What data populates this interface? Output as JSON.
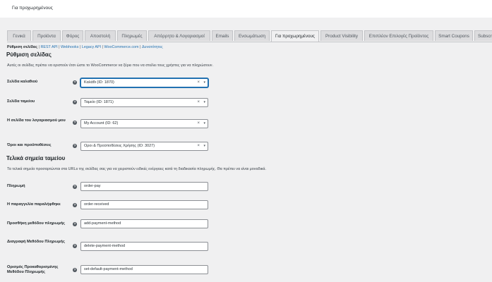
{
  "header": {
    "title": "Για προχωρημένους"
  },
  "tabs": [
    {
      "label": "Γενικά"
    },
    {
      "label": "Προϊόντα"
    },
    {
      "label": "Φόρος"
    },
    {
      "label": "Αποστολή"
    },
    {
      "label": "Πληρωμές"
    },
    {
      "label": "Απόρρητο & Λογαριασμοί"
    },
    {
      "label": "Emails"
    },
    {
      "label": "Ενσωμάτωση"
    },
    {
      "label": "Για προχωρημένους"
    },
    {
      "label": "Product Visibility"
    },
    {
      "label": "Επιπλέον Επιλογές Προϊόντος"
    },
    {
      "label": "Smart Coupons"
    },
    {
      "label": "Subscriptions"
    }
  ],
  "subnav": {
    "current": "Ρύθμιση σελίδας",
    "links": [
      "REST API",
      "Webhooks",
      "Legacy API",
      "WooCommerce.com",
      "Δυνατότητες"
    ]
  },
  "page_setup": {
    "heading": "Ρύθμιση σελίδας",
    "description": "Αυτές οι σελίδες πρέπει να οριστούν έτσι ώστε το WooCommerce να ξέρει που να στείλει τους χρήστες για να πληρώσουν.",
    "fields": [
      {
        "label": "Σελίδα καλαθιού",
        "value": "Καλάθι (ID: 1870)"
      },
      {
        "label": "Σελίδα ταμείου",
        "value": "Ταμείο (ID: 1871)"
      },
      {
        "label": "Η σελίδα του λογαριασμού μου",
        "value": "My Account (ID: 62)"
      },
      {
        "label": "Όροι και προϋποθέσεις",
        "value": "Οροι & Προϋποθέσεις Χρήσης (ID: 3027)"
      }
    ]
  },
  "endpoints": {
    "heading": "Τελικά σημεία ταμείου",
    "description": "Τα τελικά σημεία προσαρτώνται στα URLs της σελίδας σας για να χειριστούν ειδικές ενέργειες κατά τη διαδικασία πληρωμής. Θα πρέπει να είναι μοναδικά.",
    "fields": [
      {
        "label": "Πληρωμή",
        "value": "order-pay"
      },
      {
        "label": "Η παραγγελία παραλήφθηκε",
        "value": "order-received"
      },
      {
        "label": "Προσθήκη μεθόδου πληρωμής",
        "value": "add-payment-method"
      },
      {
        "label": "Διαγραφή Μεθόδου Πληρωμής",
        "value": "delete-payment-method"
      },
      {
        "label": "Ορισμός Προκαθορισμένης Μεθόδου Πληρωμής",
        "value": "set-default-payment-method"
      }
    ]
  },
  "icons": {
    "help": "help-icon",
    "clear": "clear-icon",
    "chevron": "chevron-down-icon"
  },
  "colors": {
    "link": "#2271b1",
    "background": "#f0f0f1",
    "focus": "#2271b1"
  }
}
